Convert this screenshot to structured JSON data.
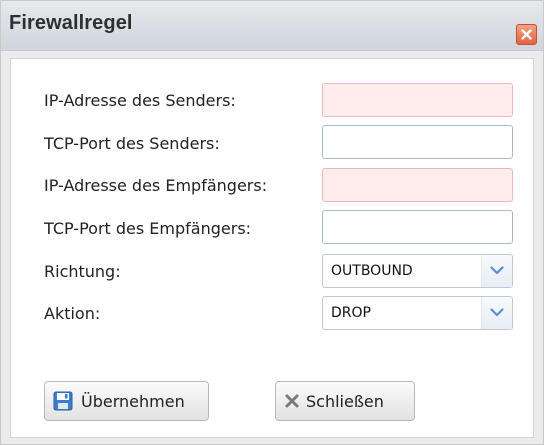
{
  "dialog": {
    "title": "Firewallregel",
    "close_icon": "close-icon"
  },
  "form": {
    "fields": [
      {
        "label": "IP-Adresse des Senders:",
        "value": "",
        "invalid": true
      },
      {
        "label": "TCP-Port des Senders:",
        "value": "",
        "invalid": false
      },
      {
        "label": "IP-Adresse des Empfängers:",
        "value": "",
        "invalid": true
      },
      {
        "label": "TCP-Port des Empfängers:",
        "value": "",
        "invalid": false
      }
    ],
    "richtung": {
      "label": "Richtung:",
      "value": "OUTBOUND"
    },
    "aktion": {
      "label": "Aktion:",
      "value": "DROP"
    }
  },
  "buttons": {
    "apply": {
      "label": "Übernehmen",
      "icon": "save-icon"
    },
    "close": {
      "label": "Schließen",
      "icon": "x-icon"
    }
  },
  "colors": {
    "invalid_bg": "#ffecec",
    "close_accent": "#e5613f"
  }
}
